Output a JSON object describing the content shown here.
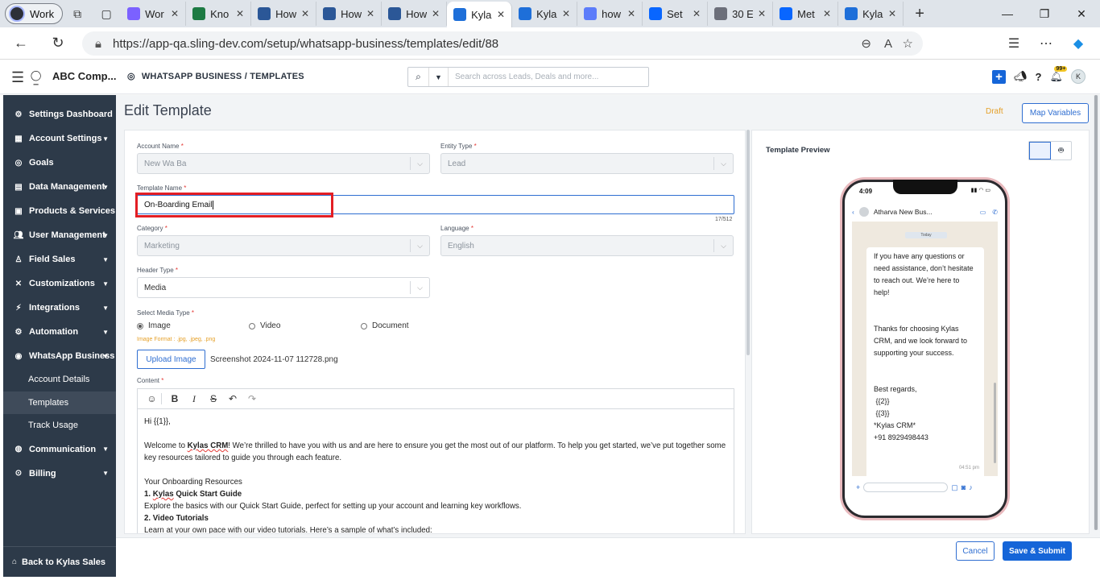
{
  "browser": {
    "profile": "Work",
    "tabs": [
      {
        "title": "Wor",
        "icon": "copilot-icon",
        "color": "#7b61ff"
      },
      {
        "title": "Kno",
        "icon": "excel-icon",
        "color": "#1d7a43"
      },
      {
        "title": "How",
        "icon": "word-icon",
        "color": "#2b5797"
      },
      {
        "title": "How",
        "icon": "word-icon",
        "color": "#2b5797"
      },
      {
        "title": "How",
        "icon": "word-icon",
        "color": "#2b5797"
      },
      {
        "title": "Kyla",
        "icon": "kylas-icon",
        "color": "#1e6fd9"
      },
      {
        "title": "Kyla",
        "icon": "kylas-icon",
        "color": "#1e6fd9"
      },
      {
        "title": "how",
        "icon": "search-icon",
        "color": "#5c7cfa"
      },
      {
        "title": "Set",
        "icon": "meta-icon",
        "color": "#0866ff"
      },
      {
        "title": "30 E",
        "icon": "s-icon",
        "color": "#6c6f7a"
      },
      {
        "title": "Met",
        "icon": "meta-icon",
        "color": "#0866ff"
      },
      {
        "title": "Kyla",
        "icon": "kylas-icon",
        "color": "#1e6fd9"
      }
    ],
    "url": "https://app-qa.sling-dev.com/setup/whatsapp-business/templates/edit/88"
  },
  "header": {
    "company": "ABC Comp...",
    "breadcrumb": "WHATSAPP BUSINESS / TEMPLATES",
    "search_placeholder": "Search across Leads, Deals and more...",
    "notification_badge": "99+",
    "user_initial": "K"
  },
  "sidebar": {
    "items": [
      {
        "label": "Settings Dashboard",
        "icon": "gear-icon",
        "caret": false
      },
      {
        "label": "Account Settings",
        "icon": "building-icon",
        "caret": true
      },
      {
        "label": "Goals",
        "icon": "target-icon",
        "caret": false
      },
      {
        "label": "Data Management",
        "icon": "table-icon",
        "caret": true
      },
      {
        "label": "Products & Services",
        "icon": "box-icon",
        "caret": false
      },
      {
        "label": "User Management",
        "icon": "users-icon",
        "caret": true
      },
      {
        "label": "Field Sales",
        "icon": "walk-icon",
        "caret": true
      },
      {
        "label": "Customizations",
        "icon": "tools-icon",
        "caret": true
      },
      {
        "label": "Integrations",
        "icon": "plug-icon",
        "caret": true
      },
      {
        "label": "Automation",
        "icon": "cogs-icon",
        "caret": true
      },
      {
        "label": "WhatsApp Business",
        "icon": "whatsapp-icon",
        "caret": true
      }
    ],
    "subitems": [
      "Account Details",
      "Templates",
      "Track Usage"
    ],
    "items_after": [
      {
        "label": "Communication",
        "icon": "chat-icon",
        "caret": true
      },
      {
        "label": "Billing",
        "icon": "billing-icon",
        "caret": true
      }
    ],
    "footer": "Back to Kylas Sales"
  },
  "page": {
    "title": "Edit Template",
    "status": "Draft",
    "map_variables": "Map Variables"
  },
  "form": {
    "account_name_label": "Account Name",
    "account_name_value": "New Wa Ba",
    "entity_type_label": "Entity Type",
    "entity_type_value": "Lead",
    "template_name_label": "Template Name",
    "template_name_value": "On-Boarding Email",
    "char_count": "17/512",
    "category_label": "Category",
    "category_value": "Marketing",
    "language_label": "Language",
    "language_value": "English",
    "header_type_label": "Header Type",
    "header_type_value": "Media",
    "media_type_label": "Select Media Type",
    "media_options": [
      "Image",
      "Video",
      "Document"
    ],
    "image_format": "Image Format : .jpg, .jpeg, .png",
    "upload_label": "Upload Image",
    "file_name": "Screenshot 2024-11-07 112728.png",
    "content_label": "Content",
    "content": {
      "line1": "Hi {{1}},",
      "welcome_pre": "Welcome to ",
      "welcome_brand": "Kylas CRM",
      "welcome_post": "! We’re thrilled to have you with us and are here to ensure you get the most out of our platform. To help you get started, we’ve put together some key resources tailored to guide you through each feature.",
      "resources": "Your Onboarding Resources",
      "item1_prefix": "1. ",
      "item1_brand": "Kylas",
      "item1_rest": " Quick Start Guide",
      "item1_desc": "Explore the basics with our Quick Start Guide, perfect for setting up your account and learning key workflows.",
      "item2_title": "2. Video Tutorials",
      "item2_desc": "Learn at your own pace with our video tutorials. Here’s a sample of what’s included:"
    }
  },
  "preview": {
    "title": "Template Preview",
    "time": "4:09",
    "contact": "Atharva New Bus...",
    "today": "Today",
    "lines": [
      "If you have any questions or need assistance, don’t hesitate to reach out. We’re here to help!",
      "Thanks for choosing Kylas CRM, and we look forward to supporting your success.",
      "Best regards,",
      " {{2}}",
      " {{3}}",
      "*Kylas CRM*",
      "+91 8929498443"
    ],
    "msg_time": "04:51 pm"
  },
  "actions": {
    "cancel": "Cancel",
    "submit": "Save & Submit"
  }
}
